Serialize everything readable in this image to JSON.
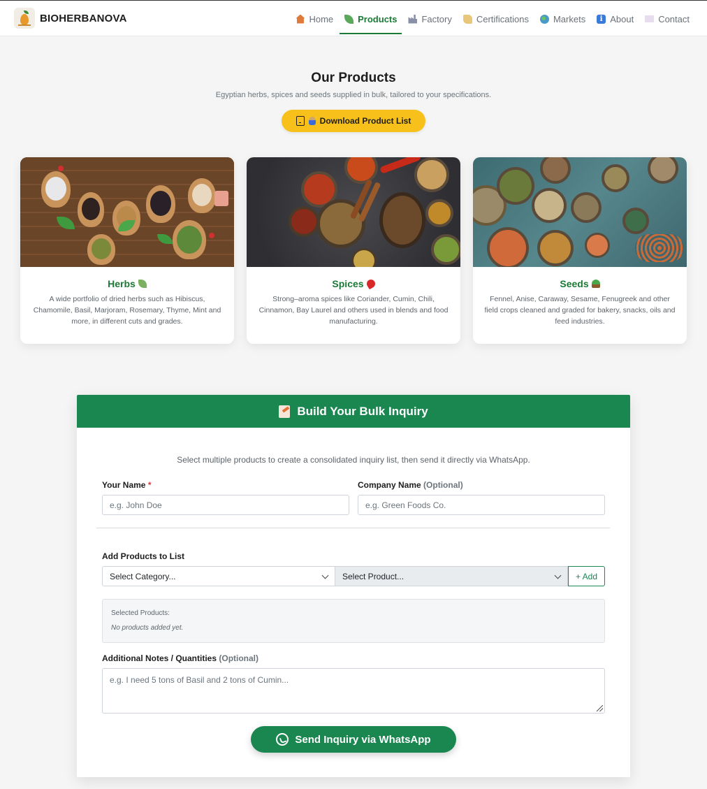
{
  "brand": {
    "name": "BIOHERBANOVA",
    "logo_icon": "leaf-drop-logo"
  },
  "nav": [
    {
      "label": "Home",
      "icon": "house-icon",
      "color": "#e07a3a",
      "active": false
    },
    {
      "label": "Products",
      "icon": "herb-icon",
      "color": "#5aa85a",
      "active": true
    },
    {
      "label": "Factory",
      "icon": "factory-icon",
      "color": "#8a8fa8",
      "active": false
    },
    {
      "label": "Certifications",
      "icon": "scroll-icon",
      "color": "#e8c77a",
      "active": false
    },
    {
      "label": "Markets",
      "icon": "globe-icon",
      "color": "#4a9ac8",
      "active": false
    },
    {
      "label": "About",
      "icon": "info-icon",
      "color": "#3a7ad8",
      "active": false
    },
    {
      "label": "Contact",
      "icon": "envelope-icon",
      "color": "#d8c8e8",
      "active": false
    }
  ],
  "products_section": {
    "title": "Our Products",
    "subtitle": "Egyptian herbs, spices and seeds supplied in bulk, tailored to your specifications.",
    "download_label": "Download Product List"
  },
  "cards": [
    {
      "title": "Herbs",
      "emoji_icon": "herb-icon",
      "desc": "A wide portfolio of dried herbs such as Hibiscus, Chamomile, Basil, Marjoram, Rosemary, Thyme, Mint and more, in different cuts and grades."
    },
    {
      "title": "Spices",
      "emoji_icon": "chili-pepper-icon",
      "desc": "Strong–aroma spices like Coriander, Cumin, Chili, Cinnamon, Bay Laurel and others used in blends and food manufacturing."
    },
    {
      "title": "Seeds",
      "emoji_icon": "seedling-icon",
      "desc": "Fennel, Anise, Caraway, Sesame, Fenugreek and other field crops cleaned and graded for bakery, snacks, oils and feed industries."
    }
  ],
  "inquiry": {
    "title": "Build Your Bulk Inquiry",
    "intro": "Select multiple products to create a consolidated inquiry list, then send it directly via WhatsApp.",
    "name_label": "Your Name",
    "name_required": "*",
    "name_placeholder": "e.g. John Doe",
    "company_label": "Company Name",
    "company_optional": "(Optional)",
    "company_placeholder": "e.g. Green Foods Co.",
    "products_label": "Add Products to List",
    "category_placeholder": "Select Category...",
    "product_placeholder": "Select Product...",
    "add_label": "+ Add",
    "selected_title": "Selected Products:",
    "selected_empty": "No products added yet.",
    "notes_label": "Additional Notes / Quantities",
    "notes_optional": "(Optional)",
    "notes_placeholder": "e.g. I need 5 tons of Basil and 2 tons of Cumin...",
    "send_label": "Send Inquiry via WhatsApp"
  },
  "colors": {
    "accent_green": "#1a8650",
    "nav_active": "#1a7a36",
    "cta_yellow": "#f7c01a"
  }
}
